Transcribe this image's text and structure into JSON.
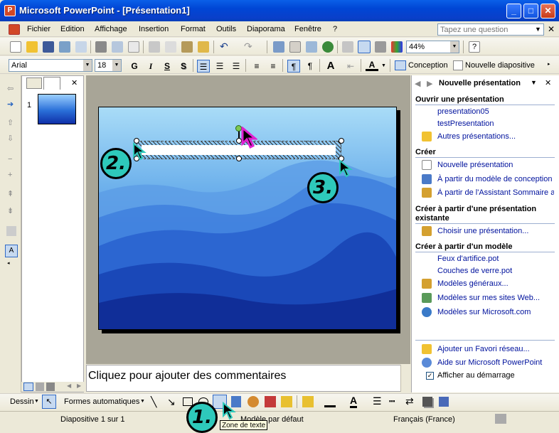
{
  "window": {
    "title": "Microsoft PowerPoint - [Présentation1]",
    "controls": {
      "minimize": "_",
      "maximize": "□",
      "close": "✕"
    }
  },
  "menu": {
    "items": [
      "Fichier",
      "Edition",
      "Affichage",
      "Insertion",
      "Format",
      "Outils",
      "Diaporama",
      "Fenêtre",
      "?"
    ],
    "ask_placeholder": "Tapez une question"
  },
  "standard_toolbar": {
    "zoom": "44%"
  },
  "formatting_toolbar": {
    "font": "Arial",
    "size": "18",
    "bold": "G",
    "italic": "I",
    "underline": "S",
    "shadow": "S",
    "design_button": "Conception",
    "new_slide_button": "Nouvelle diapositive"
  },
  "outline_pane": {
    "slide_number": "1"
  },
  "notes": {
    "placeholder": "Cliquez pour ajouter des commentaires"
  },
  "task_pane": {
    "title": "Nouvelle présentation",
    "sections": [
      {
        "heading": "Ouvrir une présentation",
        "items": [
          {
            "label": "presentation05",
            "icon": "none"
          },
          {
            "label": "testPresentation",
            "icon": "none"
          },
          {
            "label": "Autres présentations...",
            "icon": "folder-icon"
          }
        ]
      },
      {
        "heading": "Créer",
        "items": [
          {
            "label": "Nouvelle présentation",
            "icon": "blank-doc-icon"
          },
          {
            "label": "À partir du modèle de conception",
            "icon": "design-template-icon"
          },
          {
            "label": "À partir de l'Assistant Sommaire au",
            "icon": "wizard-icon"
          }
        ]
      },
      {
        "heading": "Créer à partir d'une présentation existante",
        "items": [
          {
            "label": "Choisir une présentation...",
            "icon": "choose-presentation-icon"
          }
        ]
      },
      {
        "heading": "Créer à partir d'un modèle",
        "items": [
          {
            "label": "Feux d'artifice.pot",
            "icon": "none"
          },
          {
            "label": "Couches de verre.pot",
            "icon": "none"
          },
          {
            "label": "Modèles généraux...",
            "icon": "templates-icon"
          },
          {
            "label": "Modèles sur mes sites Web...",
            "icon": "web-templates-icon"
          },
          {
            "label": "Modèles sur Microsoft.com",
            "icon": "globe-icon"
          }
        ]
      }
    ],
    "footer_items": [
      {
        "label": "Ajouter un Favori réseau...",
        "icon": "network-folder-icon"
      },
      {
        "label": "Aide sur Microsoft PowerPoint",
        "icon": "help-icon"
      }
    ],
    "startup_checkbox": {
      "label": "Afficher au démarrage",
      "checked": true
    }
  },
  "drawing_toolbar": {
    "draw_menu": "Dessin",
    "autoshapes_menu": "Formes automatiques",
    "tooltip": "Zone de texte"
  },
  "status_bar": {
    "slide": "Diapositive 1 sur 1",
    "template": "Modèle par défaut",
    "language": "Français (France)"
  },
  "callouts": [
    "1.",
    "2.",
    "3."
  ],
  "colors": {
    "accent": "#2ec9bb",
    "link": "#00129d",
    "title_bar": "#0a5fe8"
  }
}
